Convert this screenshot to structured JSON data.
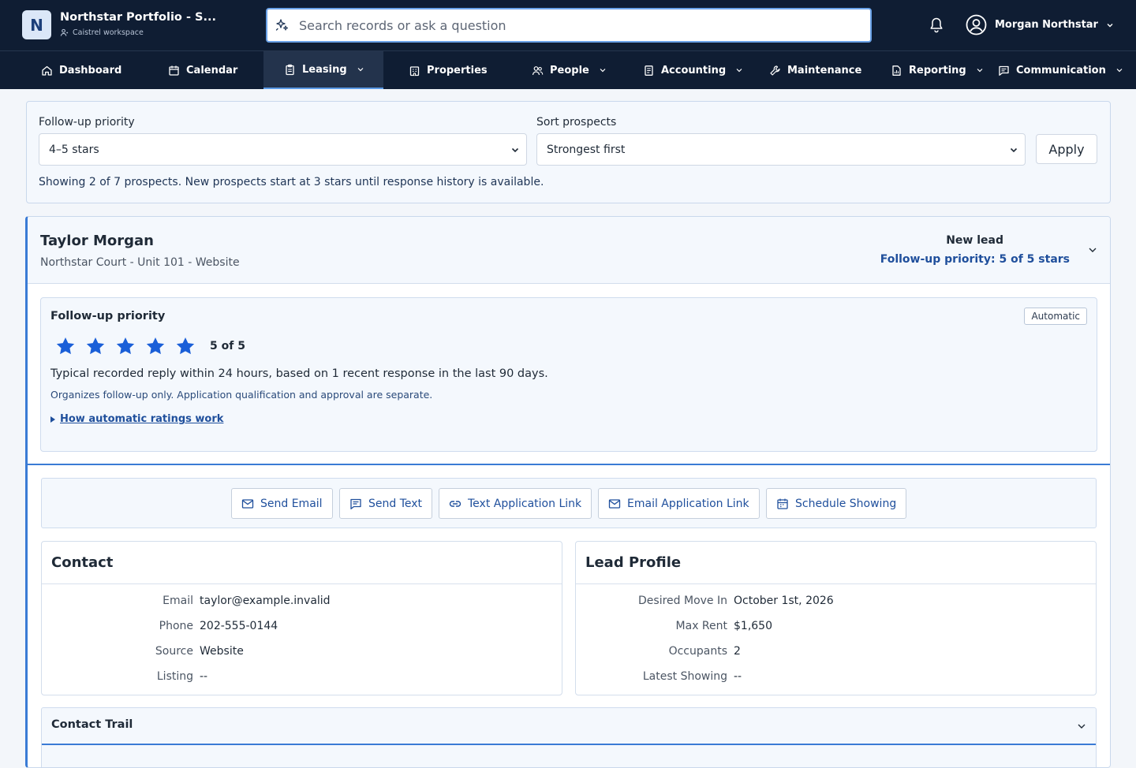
{
  "brand": {
    "logo_letter": "N",
    "title": "Northstar Portfolio - S...",
    "workspace": "Caistrel workspace"
  },
  "search": {
    "placeholder": "Search records or ask a question"
  },
  "user": {
    "name": "Morgan Northstar"
  },
  "nav": {
    "items": [
      {
        "label": "Dashboard",
        "icon": "home-icon",
        "has_menu": false
      },
      {
        "label": "Calendar",
        "icon": "calendar-icon",
        "has_menu": false
      },
      {
        "label": "Leasing",
        "icon": "clipboard-icon",
        "has_menu": true,
        "active": true
      },
      {
        "label": "Properties",
        "icon": "building-icon",
        "has_menu": false
      },
      {
        "label": "People",
        "icon": "people-icon",
        "has_menu": true
      },
      {
        "label": "Accounting",
        "icon": "ledger-icon",
        "has_menu": true
      },
      {
        "label": "Maintenance",
        "icon": "wrench-icon",
        "has_menu": false
      },
      {
        "label": "Reporting",
        "icon": "report-icon",
        "has_menu": true
      },
      {
        "label": "Communication",
        "icon": "message-icon",
        "has_menu": true
      }
    ]
  },
  "filter": {
    "priority_label": "Follow-up priority",
    "priority_value": "4–5 stars",
    "sort_label": "Sort prospects",
    "sort_value": "Strongest first",
    "apply_label": "Apply",
    "status": "Showing 2 of 7 prospects. New prospects start at 3 stars until response history is available."
  },
  "prospect": {
    "name": "Taylor Morgan",
    "subtitle": "Northstar Court - Unit 101 - Website",
    "status": "New lead",
    "priority_summary": "Follow-up priority: 5 of 5 stars",
    "follow_up": {
      "title": "Follow-up priority",
      "badge": "Automatic",
      "rating": 5,
      "rating_max": 5,
      "rating_text": "5 of 5",
      "explanation": "Typical recorded reply within 24 hours, based on 1 recent response in the last 90 days.",
      "note": "Organizes follow-up only. Application qualification and approval are separate.",
      "link": "How automatic ratings work"
    },
    "actions": [
      {
        "label": "Send Email",
        "icon": "mail-icon"
      },
      {
        "label": "Send Text",
        "icon": "chat-icon"
      },
      {
        "label": "Text Application Link",
        "icon": "link-icon"
      },
      {
        "label": "Email Application Link",
        "icon": "mail-icon"
      },
      {
        "label": "Schedule Showing",
        "icon": "calendar-icon"
      }
    ],
    "contact": {
      "title": "Contact",
      "rows": [
        {
          "label": "Email",
          "value": "taylor@example.invalid"
        },
        {
          "label": "Phone",
          "value": "202-555-0144"
        },
        {
          "label": "Source",
          "value": "Website"
        },
        {
          "label": "Listing",
          "value": "--"
        }
      ]
    },
    "lead_profile": {
      "title": "Lead Profile",
      "rows": [
        {
          "label": "Desired Move In",
          "value": "October 1st, 2026"
        },
        {
          "label": "Max Rent",
          "value": "$1,650"
        },
        {
          "label": "Occupants",
          "value": "2"
        },
        {
          "label": "Latest Showing",
          "value": "--"
        }
      ]
    },
    "contact_trail": {
      "title": "Contact Trail"
    }
  },
  "colors": {
    "topbar": "#0f1d33",
    "accent": "#3a7bd5",
    "star": "#1a5fd8",
    "link": "#1f4f9c"
  }
}
